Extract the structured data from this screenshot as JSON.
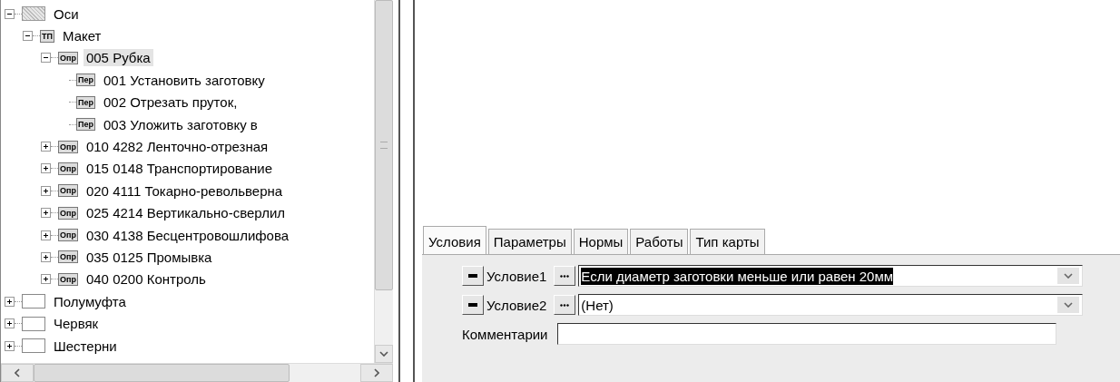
{
  "tree": [
    {
      "label": "Оси",
      "kind": "hatched",
      "expanded": true,
      "selected": false,
      "children": [
        {
          "label": "Макет",
          "kind": "badge",
          "badge": "ТП",
          "expanded": true,
          "selected": false,
          "children": [
            {
              "label": "005 Рубка",
              "kind": "badge",
              "badge": "Опр",
              "expanded": true,
              "selected": true,
              "children": [
                {
                  "label": "001 Установить заготовку",
                  "kind": "badge",
                  "badge": "Пер",
                  "selected": false
                },
                {
                  "label": "002 Отрезать пруток,",
                  "kind": "badge",
                  "badge": "Пер",
                  "selected": false
                },
                {
                  "label": "003 Уложить заготовку в",
                  "kind": "badge",
                  "badge": "Пер",
                  "selected": false
                }
              ]
            },
            {
              "label": "010 4282 Ленточно-отрезная",
              "kind": "badge",
              "badge": "Опр",
              "expanded": false,
              "selected": false
            },
            {
              "label": "015 0148 Транспортирование",
              "kind": "badge",
              "badge": "Опр",
              "expanded": false,
              "selected": false
            },
            {
              "label": "020 4111 Токарно-револьверна",
              "kind": "badge",
              "badge": "Опр",
              "expanded": false,
              "selected": false
            },
            {
              "label": "025 4214 Вертикально-сверлил",
              "kind": "badge",
              "badge": "Опр",
              "expanded": false,
              "selected": false
            },
            {
              "label": "030 4138 Бесцентровошлифова",
              "kind": "badge",
              "badge": "Опр",
              "expanded": false,
              "selected": false
            },
            {
              "label": "035 0125 Промывка",
              "kind": "badge",
              "badge": "Опр",
              "expanded": false,
              "selected": false
            },
            {
              "label": "040 0200 Контроль",
              "kind": "badge",
              "badge": "Опр",
              "expanded": false,
              "selected": false
            }
          ]
        }
      ]
    },
    {
      "label": "Полумуфта",
      "kind": "empty",
      "expanded": false,
      "selected": false
    },
    {
      "label": "Червяк",
      "kind": "empty",
      "expanded": false,
      "selected": false
    },
    {
      "label": "Шестерни",
      "kind": "empty",
      "expanded": false,
      "selected": false
    }
  ],
  "tabs": [
    {
      "label": "Условия",
      "selected": true
    },
    {
      "label": "Параметры",
      "selected": false
    },
    {
      "label": "Нормы",
      "selected": false
    },
    {
      "label": "Работы",
      "selected": false
    },
    {
      "label": "Тип карты",
      "selected": false
    }
  ],
  "conditions": [
    {
      "label": "Условие1",
      "value": "Если диаметр заготовки меньше или равен 20мм",
      "highlighted": true
    },
    {
      "label": "Условие2",
      "value": "(Нет)",
      "highlighted": false
    }
  ],
  "comment": {
    "label": "Комментарии"
  }
}
